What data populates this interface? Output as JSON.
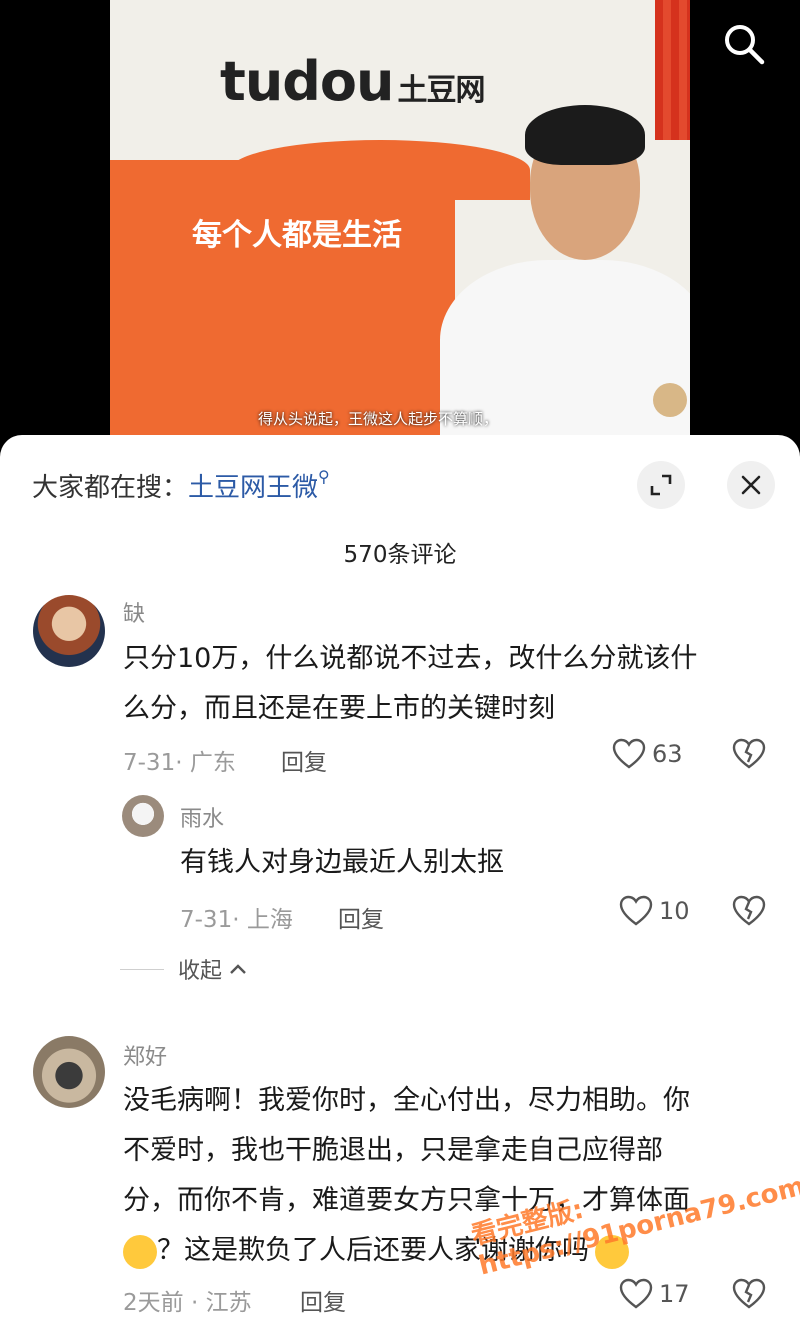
{
  "video": {
    "logo_text": "tudou",
    "logo_cn": "土豆网",
    "slogan": "每个人都是生活",
    "subtitle": "得从头说起，王微这人起步不算顺，"
  },
  "panel": {
    "suggest_prefix": "大家都在搜：",
    "suggest_keyword": "土豆网王微",
    "comment_count": "570条评论"
  },
  "comments": [
    {
      "user": "缺",
      "text_line1": "只分10万，什么说都说不过去，改什么分就该什",
      "text_line2": "么分，而且还是在要上市的关键时刻",
      "meta": "7-31· 广东",
      "reply_label": "回复",
      "likes": "63"
    },
    {
      "user": "郑好",
      "text_line1": "没毛病啊！我爱你时，全心付出，尽力相助。你",
      "text_line2": "不爱时，我也干脆退出，只是拿走自己应得部",
      "text_line3": "分，而你不肯，难道要女方只拿十万，才算体面",
      "text_line4": "？这是欺负了人后还要人家谢谢你吗",
      "meta": "2天前 · 江苏",
      "reply_label": "回复",
      "likes": "17"
    }
  ],
  "reply": {
    "user": "雨水",
    "text": "有钱人对身边最近人别太抠",
    "meta": "7-31· 上海",
    "reply_label": "回复",
    "likes": "10",
    "collapse_label": "收起"
  },
  "watermark": "看完整版: https://91porna79.com"
}
